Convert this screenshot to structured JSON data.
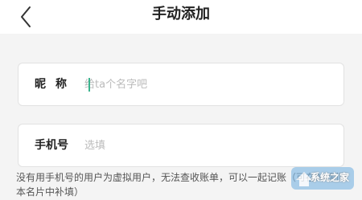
{
  "header": {
    "title": "手动添加",
    "back_icon": "chevron-left-icon"
  },
  "form": {
    "nickname": {
      "label": "昵称",
      "placeholder": "给ta个名字吧",
      "value": ""
    },
    "phone": {
      "label": "手机号",
      "placeholder": "选填",
      "value": ""
    }
  },
  "hint": "没有用手机号的用户为虚拟用户，无法查收账单，可以一起记账（可在AA制账本名片中补填）",
  "watermark": {
    "text": "系统之家",
    "icon": "house-logo-icon"
  },
  "colors": {
    "background": "#f4f4f4",
    "cursor": "#3bb48e"
  }
}
